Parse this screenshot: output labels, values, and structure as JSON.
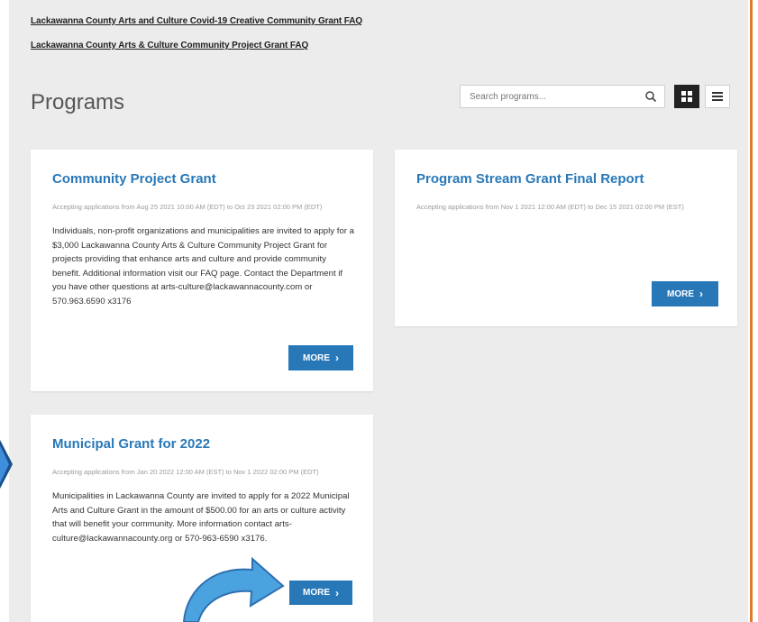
{
  "links": {
    "faq1": "Lackawanna County Arts and Culture Covid-19 Creative Community Grant FAQ",
    "faq2": "Lackawanna County Arts & Culture Community Project Grant FAQ"
  },
  "header": {
    "title": "Programs",
    "search_placeholder": "Search programs...",
    "search_icon": "magnifier-icon",
    "grid_icon": "grid-view-icon",
    "list_icon": "list-view-icon"
  },
  "cards": [
    {
      "title": "Community Project Grant",
      "meta": "Accepting applications from Aug 25 2021 10:00 AM (EDT) to Oct 23 2021 02:00 PM (EDT)",
      "description": "Individuals, non-profit organizations and municipalities are invited to apply for a $3,000 Lackawanna County Arts & Culture Community Project Grant for projects providing that enhance arts and culture and provide community benefit. Additional information visit our FAQ page. Contact the Department if you have other questions at arts-culture@lackawannacounty.com or 570.963.6590 x3176",
      "more": "MORE"
    },
    {
      "title": "Program Stream Grant Final Report",
      "meta": "Accepting applications from Nov 1 2021 12:00 AM (EDT) to Dec 15 2021 02:00 PM (EST)",
      "description": "",
      "more": "MORE"
    },
    {
      "title": "Municipal Grant for 2022",
      "meta": "Accepting applications from Jan 20 2022 12:00 AM (EST) to Nov 1 2022 02:00 PM (EDT)",
      "description": "Municipalities in Lackawanna County are invited to apply for a 2022 Municipal Arts and Culture Grant in the amount of $500.00 for an arts or culture activity that will benefit your community. More information contact arts-culture@lackawannacounty.org or 570-963-6590 x3176.",
      "more": "MORE"
    }
  ],
  "colors": {
    "accent": "#2878b8",
    "background": "#ececec",
    "border_orange": "#e07a2e",
    "annotation_arrow": "#4aa3df"
  }
}
